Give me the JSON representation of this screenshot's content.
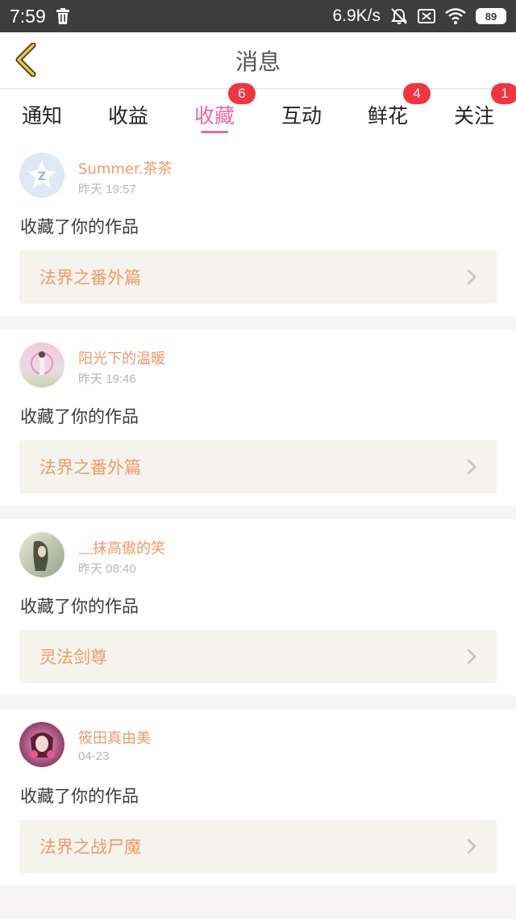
{
  "status_bar": {
    "time": "7:59",
    "net_speed": "6.9K/s",
    "battery": "89",
    "icons": [
      "trash-icon",
      "bell-muted-icon",
      "sim-disabled-icon",
      "wifi-icon",
      "battery-icon"
    ]
  },
  "header": {
    "title": "消息",
    "back_icon": "chevron-left-icon"
  },
  "tabs": [
    {
      "label": "通知",
      "badge": null
    },
    {
      "label": "收益",
      "badge": null
    },
    {
      "label": "收藏",
      "badge": "6",
      "active": true
    },
    {
      "label": "互动",
      "badge": null
    },
    {
      "label": "鲜花",
      "badge": "4"
    },
    {
      "label": "关注",
      "badge": "1"
    }
  ],
  "messages": [
    {
      "user": "Summer.茶茶",
      "time": "昨天 19:57",
      "action": "收藏了你的作品",
      "work": "法界之番外篇"
    },
    {
      "user": "阳光下的温暖",
      "time": "昨天 19:46",
      "action": "收藏了你的作品",
      "work": "法界之番外篇"
    },
    {
      "user": "﹏抹高傲的笑",
      "time": "昨天 08:40",
      "action": "收藏了你的作品",
      "work": "灵法剑尊"
    },
    {
      "user": "筱田真由美",
      "time": "04-23",
      "action": "收藏了你的作品",
      "work": "法界之战尸魔"
    }
  ],
  "colors": {
    "accent": "#e96aa4",
    "name": "#ef9b69",
    "badge": "#f2343f",
    "back_arrow": "#f2c52e"
  }
}
